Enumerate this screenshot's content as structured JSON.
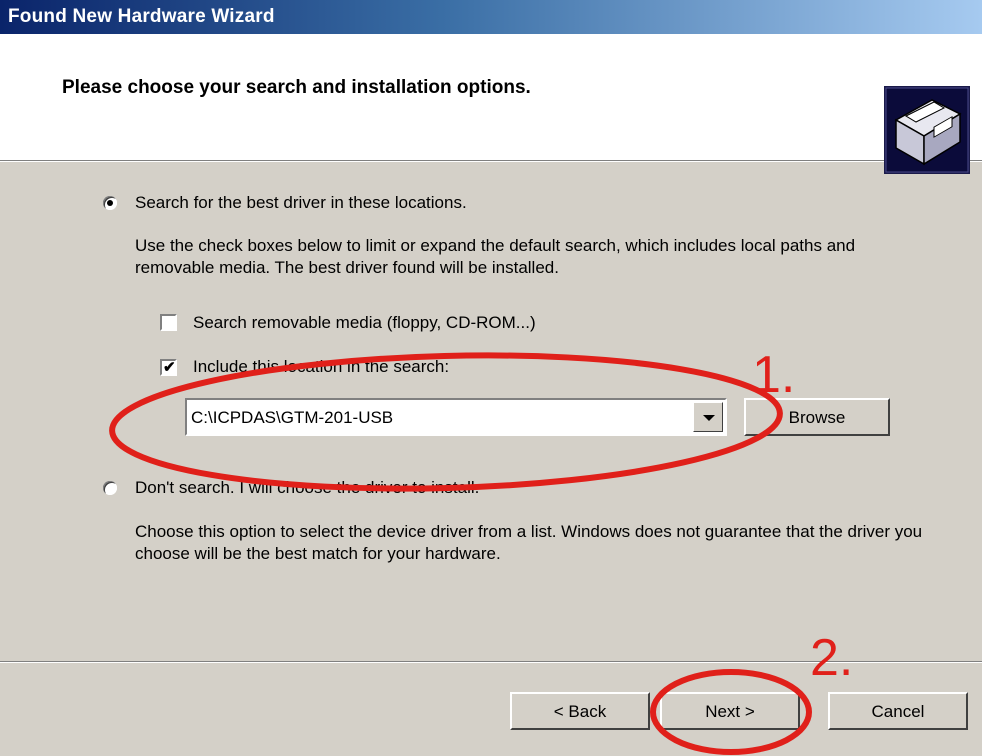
{
  "window": {
    "title": "Found New Hardware Wizard"
  },
  "header": {
    "heading": "Please choose your search and installation options."
  },
  "option_search": {
    "label": "Search for the best driver in these locations.",
    "description": "Use the check boxes below to limit or expand the default search, which includes local paths and removable media. The best driver found will be installed.",
    "selected": true
  },
  "checkbox_removable": {
    "label": "Search removable media (floppy, CD-ROM...)",
    "checked": false
  },
  "checkbox_location": {
    "label": "Include this location in the search:",
    "checked": true
  },
  "location_combo": {
    "value": "C:\\ICPDAS\\GTM-201-USB"
  },
  "browse_button": {
    "label": "Browse"
  },
  "option_manual": {
    "label": "Don't search. I will choose the driver to install.",
    "description": "Choose this option to select the device driver from a list.  Windows does not guarantee that the driver you choose will be the best match for your hardware.",
    "selected": false
  },
  "footer": {
    "back_label": "< Back",
    "next_label": "Next >",
    "cancel_label": "Cancel"
  },
  "annotations": {
    "step1": "1.",
    "step2": "2.",
    "color": "#e0201a"
  }
}
